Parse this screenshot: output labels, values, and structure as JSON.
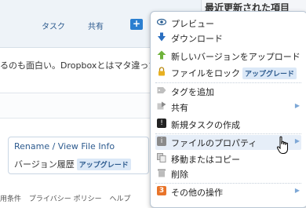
{
  "header": {
    "nav_task": "タスク",
    "nav_share": "共有",
    "plus_label": "+"
  },
  "right_panel": {
    "title": "最近更新された項目"
  },
  "main": {
    "blurb_text": "るのも面白い。Dropboxとはマタ違った"
  },
  "info_box": {
    "rename_link": "Rename / View File Info",
    "history_label": "バージョン履歴",
    "upgrade_badge": "アップグレード"
  },
  "footer": {
    "links": [
      "用条件",
      "プライバシー ポリシー",
      "ヘルプ"
    ]
  },
  "context_menu": {
    "items": [
      {
        "label": "プレビュー",
        "icon": "eye-icon"
      },
      {
        "label": "ダウンロード",
        "icon": "download-arrow-icon"
      },
      {
        "label": "新しいバージョンをアップロード",
        "icon": "upload-arrow-icon"
      },
      {
        "label": "ファイルをロック",
        "badge": "アップグレード",
        "icon": "lock-icon"
      },
      {
        "label": "タグを追加",
        "icon": "tag-icon"
      },
      {
        "label": "共有",
        "icon": "share-icon",
        "has_submenu": true
      },
      {
        "label": "新規タスクの作成",
        "icon": "task-alert-icon"
      },
      {
        "label": "ファイルのプロパティ",
        "icon": "info-icon",
        "has_submenu": true,
        "highlighted": true
      },
      {
        "label": "移動またはコピー",
        "icon": "move-copy-icon"
      },
      {
        "label": "削除",
        "icon": "trash-icon"
      },
      {
        "label": "その他の操作",
        "icon": "more-actions-icon",
        "badge_count": "3",
        "has_submenu": true
      }
    ]
  },
  "colors": {
    "accent": "#2b7fd0",
    "menu_highlight": "#e6eef8",
    "link": "#2c5a8e",
    "badge_bg": "#dbe8f7"
  }
}
